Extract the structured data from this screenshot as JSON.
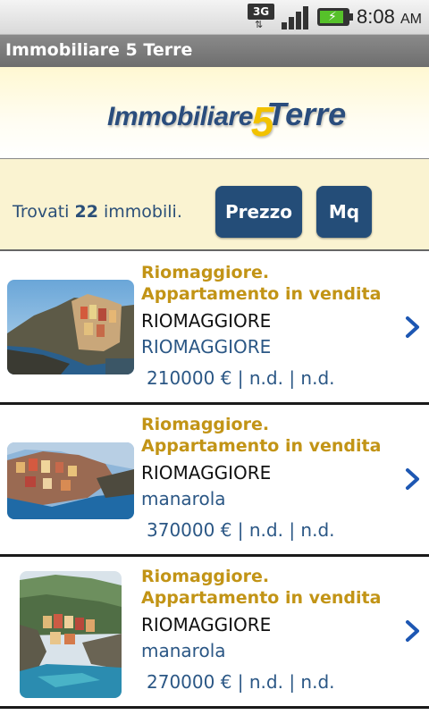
{
  "status_bar": {
    "network": "3G",
    "time": "8:08",
    "ampm": "AM"
  },
  "titlebar": {
    "title": "Immobiliare 5 Terre"
  },
  "logo": {
    "part1": "Immobiliare",
    "part2": "5",
    "part3": "Terre"
  },
  "filter": {
    "found_prefix": "Trovati",
    "found_count": "22",
    "found_suffix": "immobili.",
    "buttons": [
      "Prezzo",
      "Mq"
    ]
  },
  "listings": [
    {
      "title": "Riomaggiore. Appartamento in vendita",
      "city": "RIOMAGGIORE",
      "zone": "RIOMAGGIORE",
      "meta": "210000 € | n.d. | n.d."
    },
    {
      "title": "Riomaggiore. Appartamento in vendita",
      "city": "RIOMAGGIORE",
      "zone": "manarola",
      "meta": "370000 € | n.d. | n.d."
    },
    {
      "title": "Riomaggiore. Appartamento in vendita",
      "city": "RIOMAGGIORE",
      "zone": "manarola",
      "meta": "270000 € | n.d. | n.d."
    }
  ],
  "colors": {
    "accent_blue": "#244d78",
    "title_gold": "#c29416",
    "filter_bg": "#faf3d1"
  }
}
